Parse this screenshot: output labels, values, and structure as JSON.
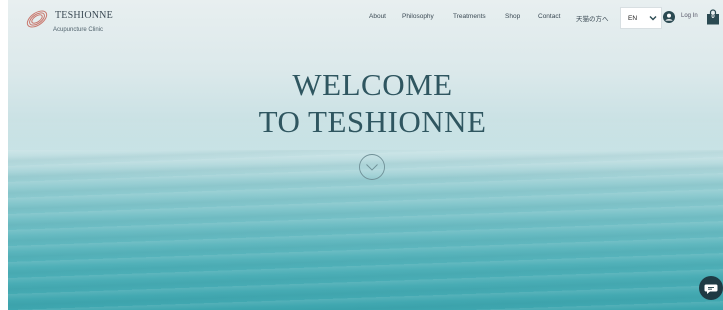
{
  "site": {
    "brand_name": "TESHIONNE",
    "brand_subtitle": "Acupuncture Clinic"
  },
  "nav": {
    "items": [
      {
        "label": "About"
      },
      {
        "label": "Philosophy"
      },
      {
        "label": "Treatments"
      },
      {
        "label": "Shop"
      },
      {
        "label": "Contact"
      },
      {
        "label": "天猫の方へ"
      }
    ]
  },
  "header_actions": {
    "language": "EN",
    "login_label": "Log In",
    "cart_count": "0"
  },
  "hero": {
    "title_line1": "WELCOME",
    "title_line2": "TO TESHIONNE"
  },
  "icons": {
    "logo": "concentric-rings-logo",
    "scroll": "chevron-down-circle-icon",
    "avatar": "user-avatar-icon",
    "cart": "shopping-bag-icon",
    "chat": "chat-bubble-icon"
  },
  "colors": {
    "text_dark": "#3b4a54",
    "title": "#2f5660",
    "accent_logo": "#c9786e",
    "cart": "#2b4a52",
    "chat": "#1e3a44"
  }
}
